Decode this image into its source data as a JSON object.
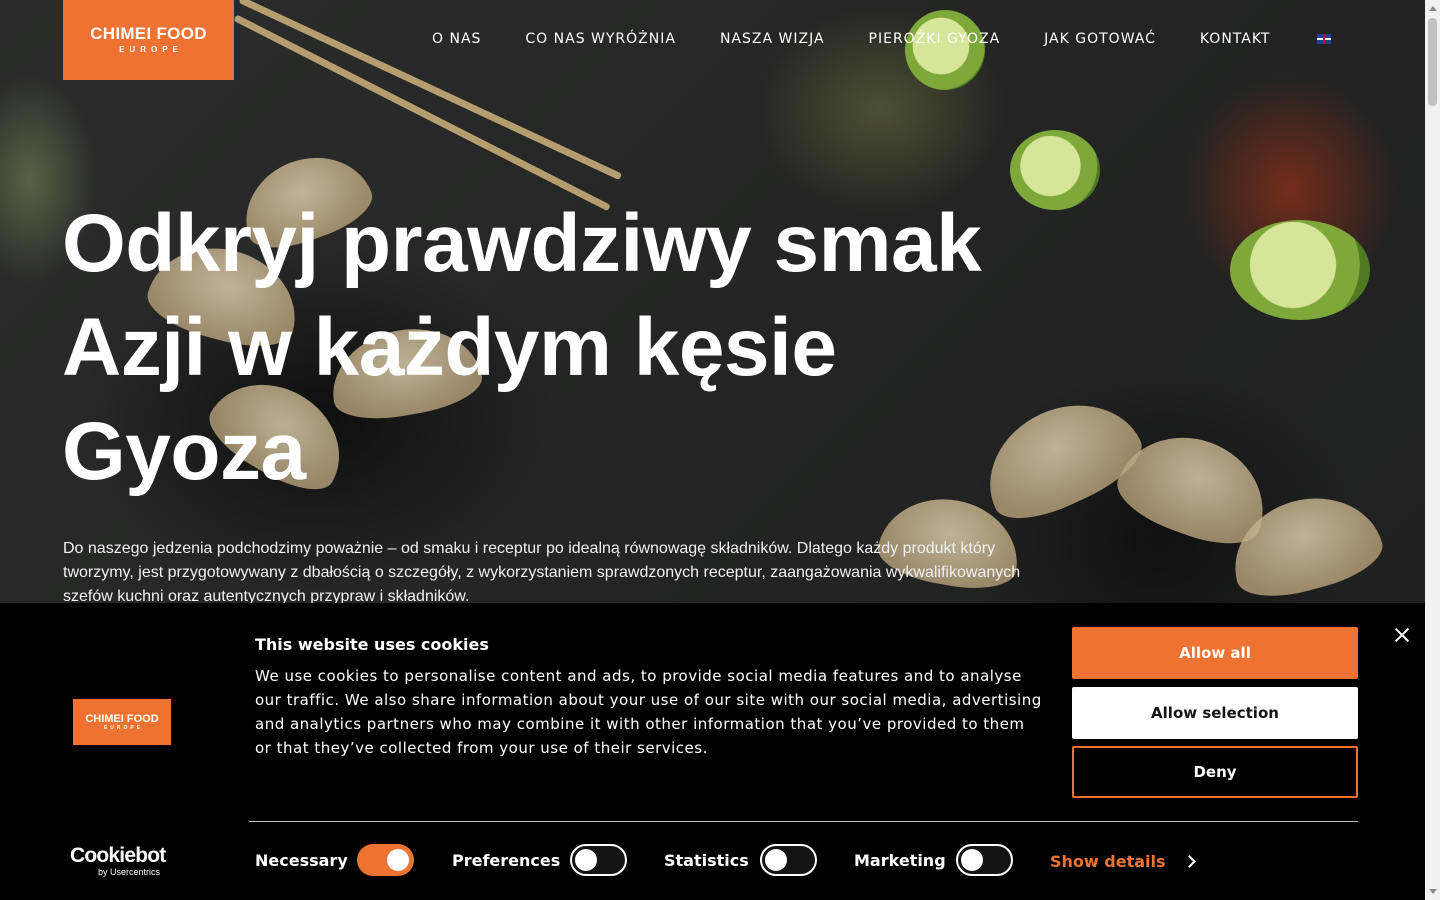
{
  "header": {
    "logo_line1": "CHIMEI FOOD",
    "logo_line2": "EUROPE",
    "nav": [
      "O NAS",
      "CO NAS WYRÓŻNIA",
      "NASZA WIZJA",
      "PIEROŻKI GYOZA",
      "JAK GOTOWAĆ",
      "KONTAKT"
    ],
    "language_icon": "uk-flag-icon"
  },
  "hero": {
    "headline_lines": [
      "Odkryj prawdziwy smak",
      "Azji w każdym kęsie",
      "Gyoza"
    ],
    "intro": "Do naszego jedzenia podchodzimy poważnie – od smaku i receptur po idealną równowagę składników. Dlatego każdy produkt który tworzymy, jest przygotowywany z dbałością o szczegóły, z wykorzystaniem sprawdzonych receptur, zaangażowania wykwalifikowanych szefów kuchni oraz autentycznych przypraw i składników."
  },
  "cookie_banner": {
    "logo_line1": "CHIMEI FOOD",
    "logo_line2": "EUROPE",
    "title": "This website uses cookies",
    "text": "We use cookies to personalise content and ads, to provide social media features and to analyse our traffic. We also share information about your use of our site with our social media, advertising and analytics partners who may combine it with other information that you’ve provided to them or that they’ve collected from your use of their services.",
    "allow_all": "Allow all",
    "allow_selection": "Allow selection",
    "deny": "Deny",
    "close_icon": "close-icon",
    "consents": [
      {
        "label": "Necessary",
        "checked": true
      },
      {
        "label": "Preferences",
        "checked": false
      },
      {
        "label": "Statistics",
        "checked": false
      },
      {
        "label": "Marketing",
        "checked": false
      }
    ],
    "show_details": "Show details",
    "brand_main": "Cookiebot",
    "brand_sub": "by Usercentrics"
  },
  "colors": {
    "accent": "#ee7231",
    "banner_bg": "#000000"
  }
}
